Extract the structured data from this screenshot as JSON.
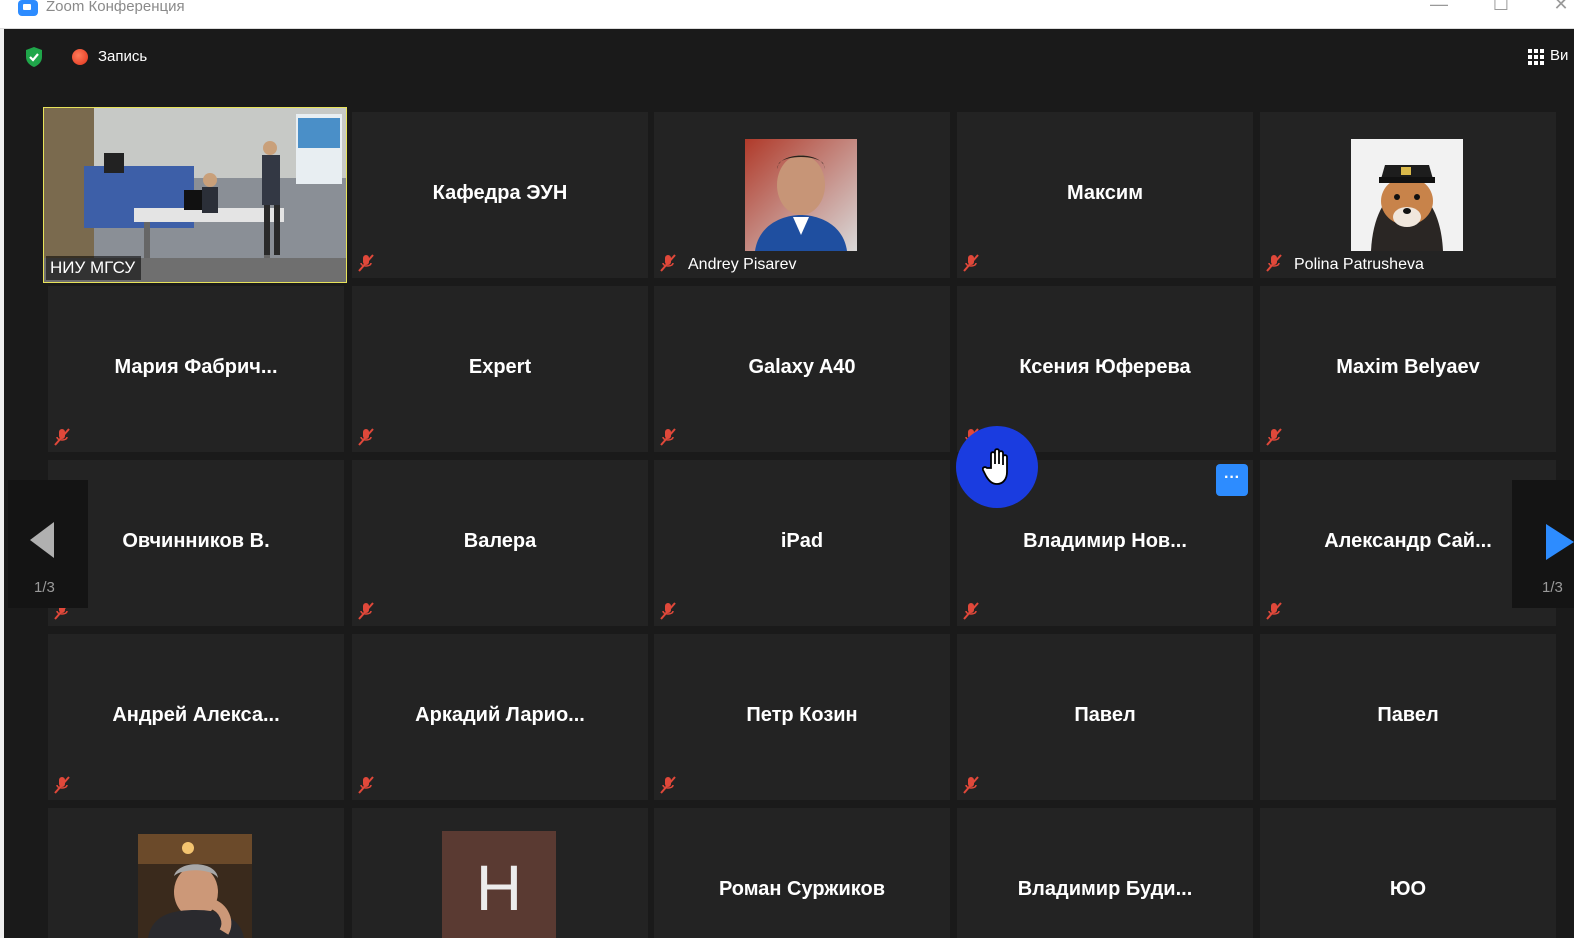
{
  "window": {
    "title": "Zoom Конференция",
    "controls": {
      "minimize": "—",
      "maximize": "☐",
      "close": "✕"
    }
  },
  "topbar": {
    "recording_label": "Запись",
    "view_label": "Ви"
  },
  "pagination": {
    "left_indicator": "1/3",
    "right_indicator": "1/3"
  },
  "more_button": "···",
  "participants": [
    {
      "name": "НИУ МГСУ",
      "kind": "video-label",
      "muted": false,
      "active_speaker": true
    },
    {
      "name": "Кафедра ЭУН",
      "kind": "center",
      "muted": true
    },
    {
      "name": "Andrey Pisarev",
      "kind": "photo-label",
      "muted": true
    },
    {
      "name": "Максим",
      "kind": "center",
      "muted": true
    },
    {
      "name": "Polina Patrusheva",
      "kind": "photo-label",
      "muted": true
    },
    {
      "name": "Мария  Фабрич...",
      "kind": "center",
      "muted": true
    },
    {
      "name": "Expert",
      "kind": "center",
      "muted": true
    },
    {
      "name": "Galaxy A40",
      "kind": "center",
      "muted": true
    },
    {
      "name": "Ксения Юферева",
      "kind": "center",
      "muted": true
    },
    {
      "name": "Maxim Belyaev",
      "kind": "center",
      "muted": true
    },
    {
      "name": "Овчинников В.",
      "kind": "center",
      "muted": true
    },
    {
      "name": "Валера",
      "kind": "center",
      "muted": true
    },
    {
      "name": "iPad",
      "kind": "center",
      "muted": true
    },
    {
      "name": "Владимир  Нов...",
      "kind": "center",
      "muted": true
    },
    {
      "name": "Александр  Сай...",
      "kind": "center",
      "muted": true
    },
    {
      "name": "Андрей  Алекса...",
      "kind": "center",
      "muted": true
    },
    {
      "name": "Аркадий  Ларио...",
      "kind": "center",
      "muted": true
    },
    {
      "name": "Петр Козин",
      "kind": "center",
      "muted": true
    },
    {
      "name": "Павел",
      "kind": "center",
      "muted": true
    },
    {
      "name": "Павел",
      "kind": "center",
      "muted": false
    },
    {
      "name": "",
      "kind": "photo",
      "muted": false
    },
    {
      "name": "",
      "kind": "letter",
      "letter": "H",
      "muted": false
    },
    {
      "name": "Роман Суржиков",
      "kind": "center",
      "muted": false
    },
    {
      "name": "Владимир  Буди...",
      "kind": "center",
      "muted": false
    },
    {
      "name": "ЮО",
      "kind": "center",
      "muted": false
    }
  ],
  "colors": {
    "background": "#1a1a1a",
    "tile": "#232323",
    "active_speaker_border": "#e8e35a",
    "mute_icon": "#e0483a",
    "accent": "#2d8cff",
    "hand_cursor_circle": "#1a3ce0"
  }
}
